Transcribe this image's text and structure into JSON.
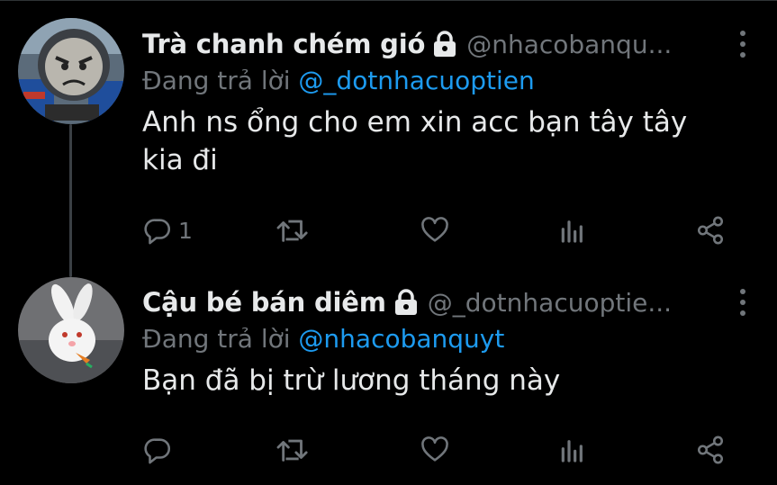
{
  "tweets": [
    {
      "display_name": "Trà chanh chém gió",
      "handle": "@nhacobanqu...",
      "reply_prefix": "Đang trả lời",
      "reply_to": "@_dotnhacuoptien",
      "text": "Anh ns ổng cho em xin acc bạn tây tây kia đi",
      "reply_count": "1",
      "avatar_icon": "angry-train-face-avatar"
    },
    {
      "display_name": "Cậu bé bán diêm",
      "handle": "@_dotnhacuoptie...",
      "reply_prefix": "Đang trả lời",
      "reply_to": "@nhacobanquyt",
      "text": "Bạn đã bị trừ lương tháng này",
      "reply_count": "",
      "avatar_icon": "white-rabbit-avatar"
    }
  ],
  "colors": {
    "background": "#000000",
    "text": "#e7e9ea",
    "secondary": "#71767b",
    "mention": "#1d9bf0",
    "thread_line": "#3a3f44"
  }
}
